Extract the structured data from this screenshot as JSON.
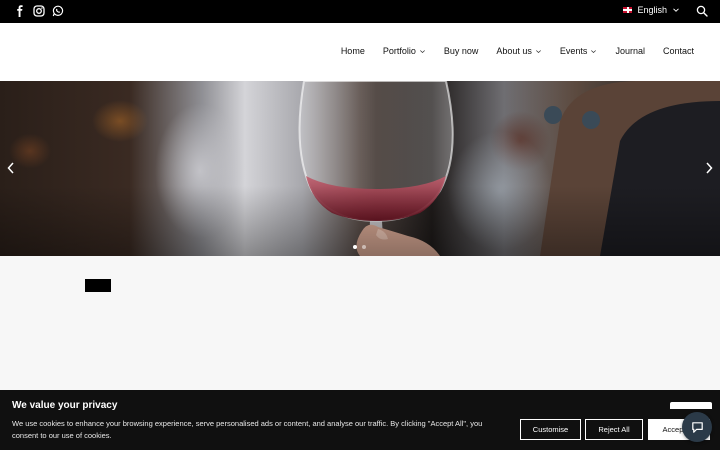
{
  "topbar": {
    "social_icons": [
      "facebook-icon",
      "instagram-icon",
      "whatsapp-icon"
    ],
    "language": "English",
    "language_flag": "uk-flag-icon"
  },
  "nav": {
    "items": [
      {
        "label": "Home",
        "has_dropdown": false
      },
      {
        "label": "Portfolio",
        "has_dropdown": true
      },
      {
        "label": "Buy now",
        "has_dropdown": false
      },
      {
        "label": "About us",
        "has_dropdown": true
      },
      {
        "label": "Events",
        "has_dropdown": true
      },
      {
        "label": "Journal",
        "has_dropdown": false
      },
      {
        "label": "Contact",
        "has_dropdown": false
      }
    ]
  },
  "hero": {
    "image_subject": "hand holding wine glass with red wine",
    "slide_count": 2,
    "active_slide": 1
  },
  "cookie": {
    "title": "We value your privacy",
    "text": "We use cookies to enhance your browsing experience, serve personalised ads or content, and analyse our traffic. By clicking \"Accept All\", you consent to our use of cookies.",
    "customise_label": "Customise",
    "reject_label": "Reject All",
    "accept_label": "Accept All"
  },
  "colors": {
    "topbar_bg": "#000000",
    "cookie_bg": "#101010",
    "chat_button": "#2b3a48"
  }
}
